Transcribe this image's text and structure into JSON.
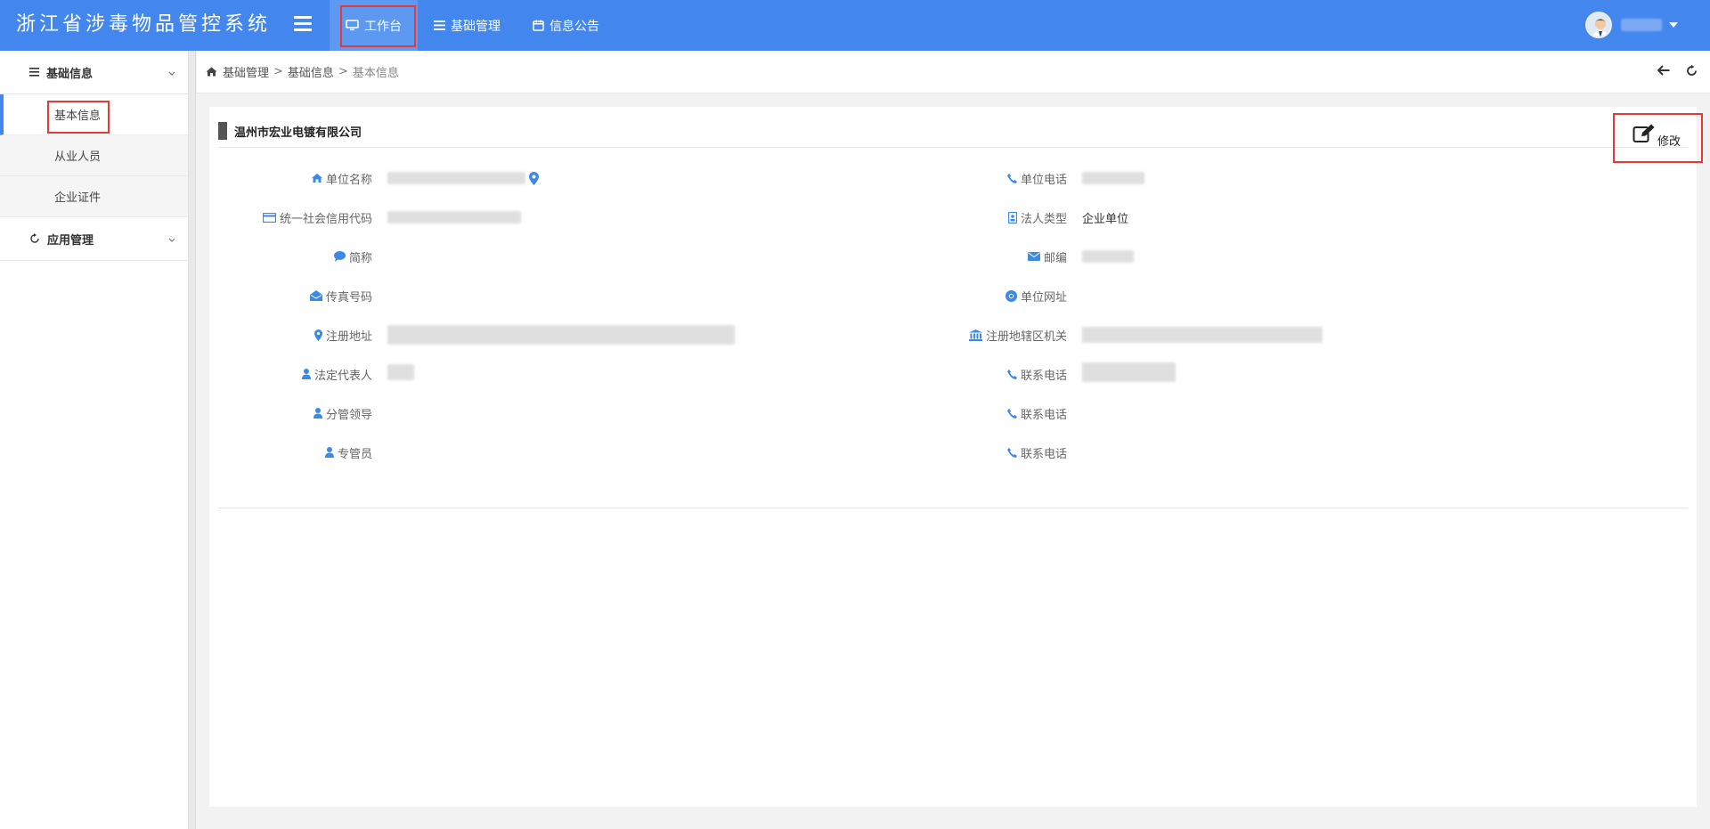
{
  "app": {
    "title": "浙江省涉毒物品管控系统"
  },
  "nav": {
    "items": [
      {
        "label": "工作台"
      },
      {
        "label": "基础管理"
      },
      {
        "label": "信息公告"
      }
    ]
  },
  "sidebar": {
    "group1": "基础信息",
    "sub": [
      "基本信息",
      "从业人员",
      "企业证件"
    ],
    "group2": "应用管理"
  },
  "breadcrumb": {
    "items": [
      "基础管理",
      "基础信息",
      "基本信息"
    ],
    "sep": ">"
  },
  "card": {
    "company": "温州市宏业电镀有限公司",
    "edit_label": "修改"
  },
  "fields_left": [
    {
      "label": "单位名称",
      "icon": "home-icon"
    },
    {
      "label": "统一社会信用代码",
      "icon": "credit-card-icon"
    },
    {
      "label": "简称",
      "icon": "comment-icon"
    },
    {
      "label": "传真号码",
      "icon": "envelope-open-icon"
    },
    {
      "label": "注册地址",
      "icon": "map-marker-icon"
    },
    {
      "label": "法定代表人",
      "icon": "user-icon"
    },
    {
      "label": "分管领导",
      "icon": "user-icon"
    },
    {
      "label": "专管员",
      "icon": "user-icon"
    }
  ],
  "fields_right": [
    {
      "label": "单位电话",
      "icon": "phone-icon"
    },
    {
      "label": "法人类型",
      "icon": "id-badge-icon",
      "value": "企业单位"
    },
    {
      "label": "邮编",
      "icon": "envelope-icon"
    },
    {
      "label": "单位网址",
      "icon": "chrome-icon"
    },
    {
      "label": "注册地辖区机关",
      "icon": "bank-icon"
    },
    {
      "label": "联系电话",
      "icon": "phone-icon"
    },
    {
      "label": "联系电话",
      "icon": "phone-icon"
    },
    {
      "label": "联系电话",
      "icon": "phone-icon"
    }
  ],
  "colors": {
    "primary": "#4387ee",
    "icon_blue": "#3b8ae6",
    "highlight": "#e53935"
  }
}
